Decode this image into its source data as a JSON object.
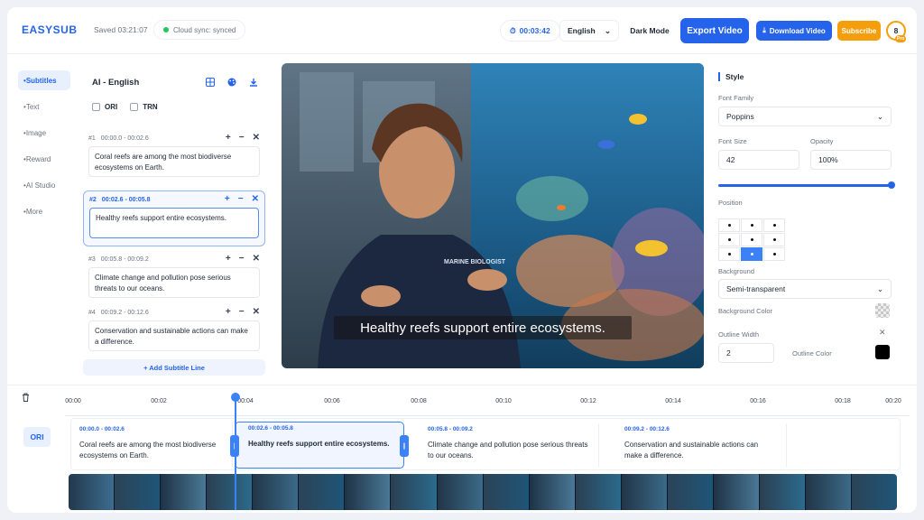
{
  "header": {
    "logo": "EASYSUB",
    "saved": "Saved 03:21:07",
    "sync": "Cloud sync: synced",
    "timer": "00:03:42",
    "language": "English",
    "dark_mode": "Dark Mode",
    "export": "Export Video",
    "download": "Download Video",
    "subscribe": "Subscribe",
    "avatar": "8",
    "badge": "Pro"
  },
  "nav": {
    "items": [
      {
        "label": "Subtitles",
        "active": true
      },
      {
        "label": "Text"
      },
      {
        "label": "Image"
      },
      {
        "label": "Reward"
      },
      {
        "label": "AI Studio"
      },
      {
        "label": "More"
      }
    ]
  },
  "subtitles": {
    "title": "AI - English",
    "check_ori": "ORI",
    "check_trn": "TRN",
    "add_line": "+ Add Subtitle Line",
    "cards": [
      {
        "num": "#1",
        "time": "00:00.0 - 00:02.6",
        "text": "Coral reefs are among the most biodiverse ecosystems on Earth."
      },
      {
        "num": "#2",
        "time": "00:02.6 - 00:05.8",
        "text": "Healthy reefs support entire ecosystems."
      },
      {
        "num": "#3",
        "time": "00:05.8 - 00:09.2",
        "text": "Climate change and pollution pose serious threats to our oceans."
      },
      {
        "num": "#4",
        "time": "00:09.2 - 00:12.6",
        "text": "Conservation and sustainable actions can make a difference."
      }
    ]
  },
  "video": {
    "caption": "Healthy reefs support entire ecosystems.",
    "shirt_text": "MARINE BIOLOGIST"
  },
  "style": {
    "title": "Style",
    "font_family_label": "Font Family",
    "font_family": "Poppins",
    "font_size_label": "Font Size",
    "font_size": "42",
    "opacity_label": "Opacity",
    "opacity": "100%",
    "position_label": "Position",
    "background_label": "Background",
    "background": "Semi-transparent",
    "bg_color_label": "Background Color",
    "outline_width_label": "Outline Width",
    "outline_width": "2",
    "outline_color_label": "Outline Color",
    "outline_color": "#000000"
  },
  "timeline": {
    "ticks": [
      "00:00",
      "00:02",
      "00:04",
      "00:06",
      "00:08",
      "00:10",
      "00:12",
      "00:14",
      "00:16",
      "00:18",
      "00:20"
    ],
    "track_label": "ORI",
    "segments": [
      {
        "time": "00:00.0 - 00:02.6",
        "text": "Coral reefs are among the most biodiverse ecosystems on Earth."
      },
      {
        "time": "00:02.6 - 00:05.8",
        "text": "Healthy reefs support entire ecosystems."
      },
      {
        "time": "00:05.8 - 00:09.2",
        "text": "Climate change and pollution pose serious threats to our oceans."
      },
      {
        "time": "00:09.2 - 00:12.6",
        "text": "Conservation and sustainable actions can make a difference."
      }
    ]
  }
}
